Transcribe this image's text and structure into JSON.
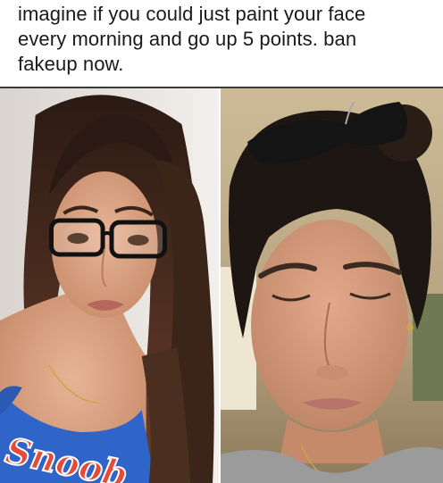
{
  "caption": {
    "lines": [
      "imagine if you could just paint your face",
      "every morning and go up 5 points. ban",
      "fakeup now."
    ]
  },
  "photos": {
    "left": {
      "icon": "portrait-with-makeup-glasses-photo",
      "shirt_text": "Snoob"
    },
    "right": {
      "icon": "portrait-without-makeup-sunglasses-photo"
    }
  },
  "colors": {
    "text": "#1a1a1a",
    "background": "#ffffff",
    "left_bg": "#e9e4df",
    "left_shirt": "#2f64c8",
    "right_bg": "#d6c8a8",
    "right_shirt": "#9b9b9b",
    "skin": "#d9a07f",
    "hair": "#2a1c16"
  }
}
